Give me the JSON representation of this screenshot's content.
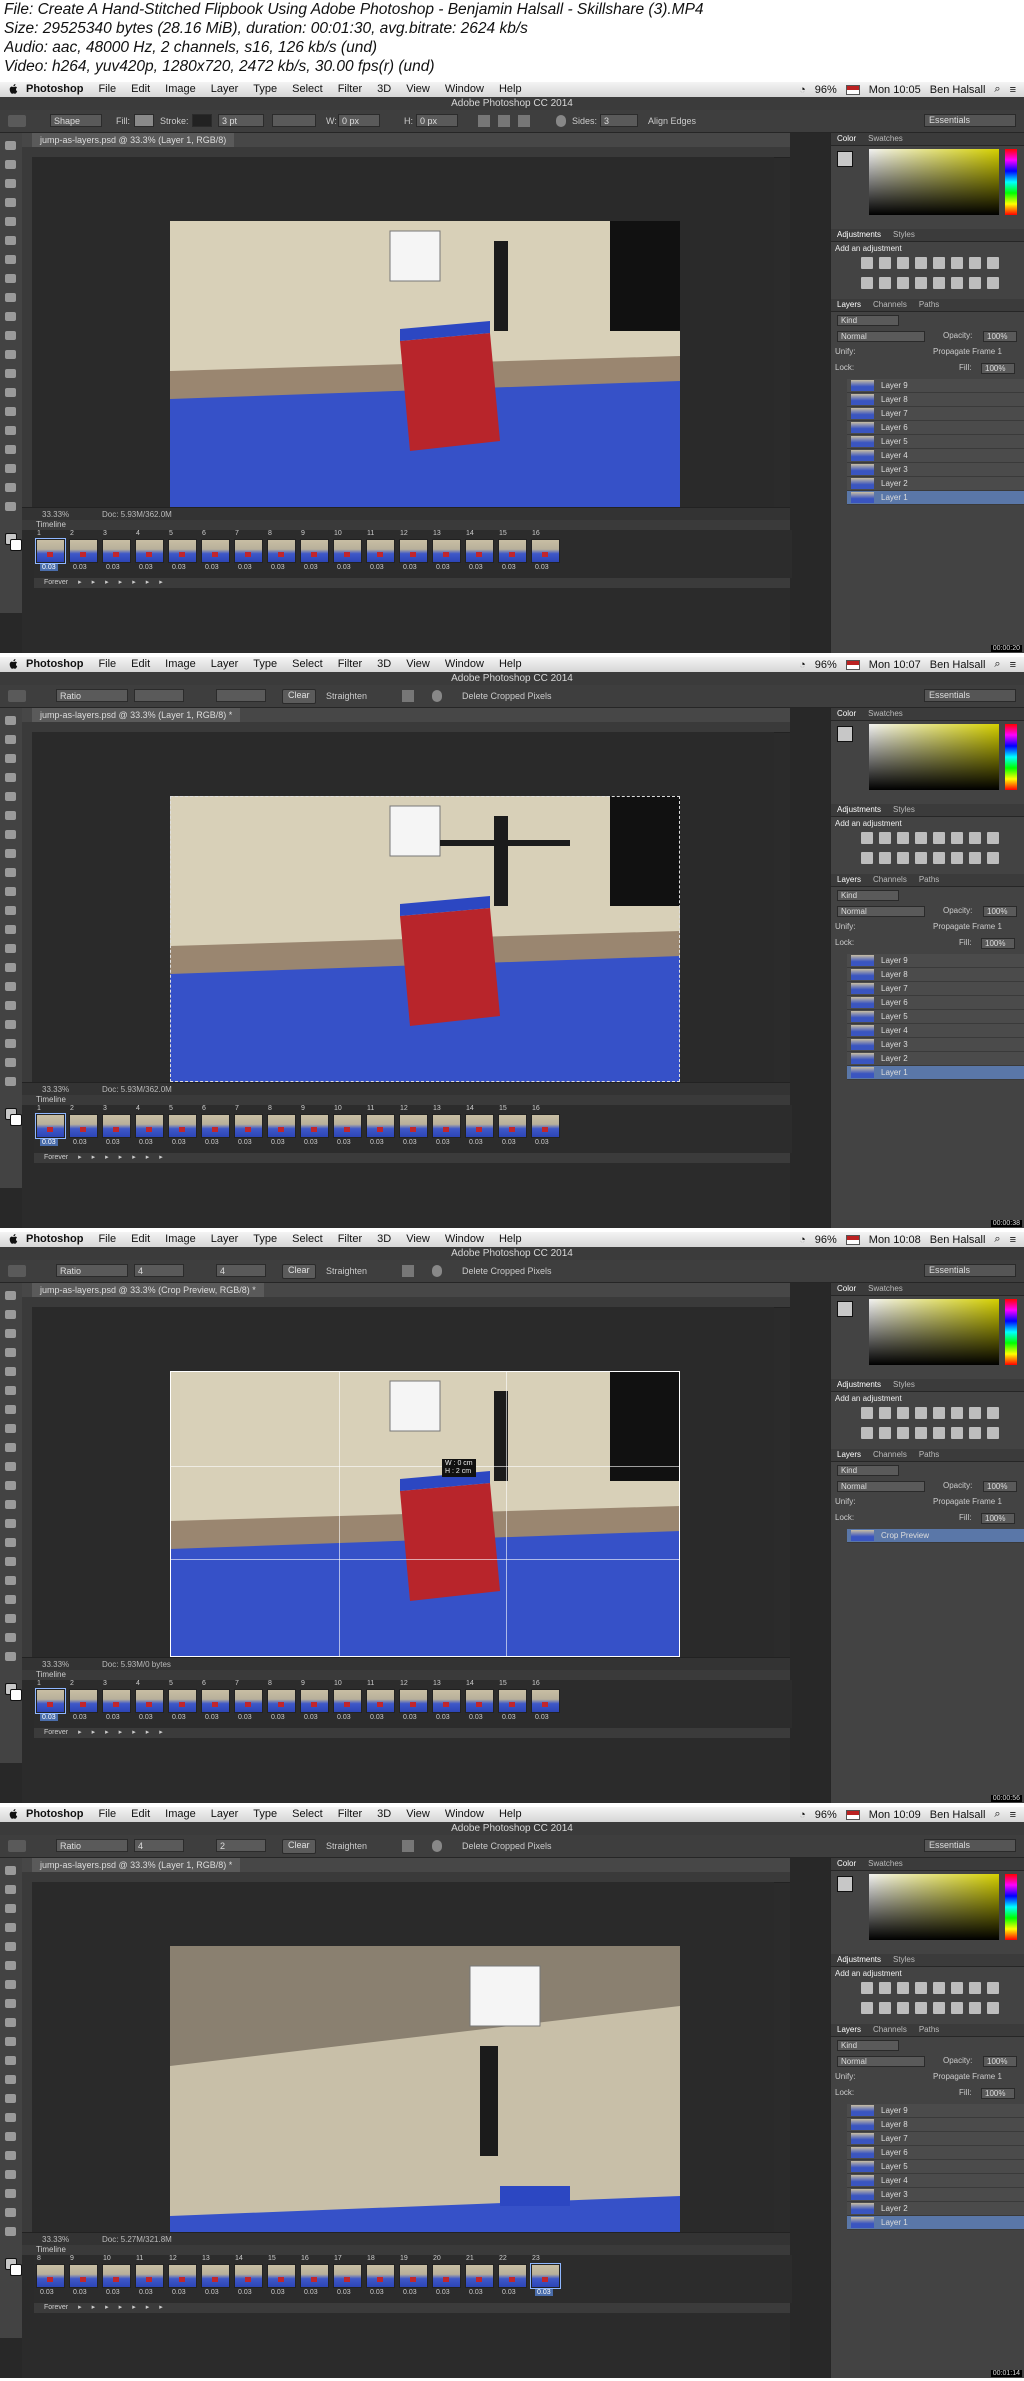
{
  "info": {
    "line1": "File: Create A Hand-Stitched Flipbook Using Adobe Photoshop - Benjamin Halsall - Skillshare (3).MP4",
    "line2": "Size: 29525340 bytes (28.16 MiB), duration: 00:01:30, avg.bitrate: 2624 kb/s",
    "line3": "Audio: aac, 48000 Hz, 2 channels, s16, 126 kb/s (und)",
    "line4": "Video: h264, yuv420p, 1280x720, 2472 kb/s, 30.00 fps(r) (und)"
  },
  "menus": [
    "Photoshop",
    "File",
    "Edit",
    "Image",
    "Layer",
    "Type",
    "Select",
    "Filter",
    "3D",
    "View",
    "Window",
    "Help"
  ],
  "status_user": "Ben Halsall",
  "status_battery": "96%",
  "app_title": "Adobe Photoshop CC 2014",
  "workspace": "Essentials",
  "panels": {
    "color_tab": "Color",
    "swatches_tab": "Swatches",
    "adjustments_tab": "Adjustments",
    "styles_tab": "Styles",
    "add_adjustment": "Add an adjustment",
    "layers_tab": "Layers",
    "channels_tab": "Channels",
    "paths_tab": "Paths",
    "kind": "Kind",
    "normal": "Normal",
    "opacity_label": "Opacity:",
    "opacity": "100%",
    "unify": "Unify:",
    "propagate": "Propagate Frame 1",
    "lock": "Lock:",
    "fill_label": "Fill:",
    "fill": "100%"
  },
  "timeline_label": "Timeline",
  "forever": "Forever",
  "frames_data": [
    {
      "clock": "Mon 10:05",
      "tool_options": {
        "shape": "Shape",
        "fill": "Fill:",
        "stroke": "Stroke:",
        "stroke_size": "3 pt",
        "w_label": "W:",
        "w": "0 px",
        "h_label": "H:",
        "h": "0 px",
        "sides_label": "Sides:",
        "sides": "3",
        "align": "Align Edges"
      },
      "doc_tab": "jump-as-layers.psd @ 33.3% (Layer 1, RGB/8)",
      "zoom": "33.33%",
      "doc_size": "Doc: 5.93M/362.0M",
      "frame_numbers": [
        "1",
        "2",
        "3",
        "4",
        "5",
        "6",
        "7",
        "8",
        "9",
        "10",
        "11",
        "12",
        "13",
        "14",
        "15",
        "16"
      ],
      "frame_delay": "0.03",
      "layers": [
        "Layer 9",
        "Layer 8",
        "Layer 7",
        "Layer 6",
        "Layer 5",
        "Layer 4",
        "Layer 3",
        "Layer 2",
        "Layer 1"
      ],
      "timecode": "00:00:20"
    },
    {
      "clock": "Mon 10:07",
      "tool_options": {
        "ratio": "Ratio",
        "clear": "Clear",
        "straighten": "Straighten",
        "delete_cropped": "Delete Cropped Pixels"
      },
      "doc_tab": "jump-as-layers.psd @ 33.3% (Layer 1, RGB/8) *",
      "zoom": "33.33%",
      "doc_size": "Doc: 5.93M/362.0M",
      "frame_numbers": [
        "1",
        "2",
        "3",
        "4",
        "5",
        "6",
        "7",
        "8",
        "9",
        "10",
        "11",
        "12",
        "13",
        "14",
        "15",
        "16"
      ],
      "frame_delay": "0.03",
      "layers": [
        "Layer 9",
        "Layer 8",
        "Layer 7",
        "Layer 6",
        "Layer 5",
        "Layer 4",
        "Layer 3",
        "Layer 2",
        "Layer 1"
      ],
      "timecode": "00:00:38"
    },
    {
      "clock": "Mon 10:08",
      "tool_options": {
        "ratio": "Ratio",
        "ratio_w": "4",
        "ratio_h": "4",
        "clear": "Clear",
        "straighten": "Straighten",
        "delete_cropped": "Delete Cropped Pixels"
      },
      "doc_tab": "jump-as-layers.psd @ 33.3% (Crop Preview, RGB/8) *",
      "zoom": "33.33%",
      "doc_size": "Doc: 5.93M/0 bytes",
      "crop_readout_w": "W : 0 cm",
      "crop_readout_h": "H : 2 cm",
      "frame_numbers": [
        "1",
        "2",
        "3",
        "4",
        "5",
        "6",
        "7",
        "8",
        "9",
        "10",
        "11",
        "12",
        "13",
        "14",
        "15",
        "16"
      ],
      "frame_delay": "0.03",
      "layers": [
        "Crop Preview"
      ],
      "timecode": "00:00:56"
    },
    {
      "clock": "Mon 10:09",
      "tool_options": {
        "ratio": "Ratio",
        "ratio_w": "4",
        "ratio_h": "2",
        "clear": "Clear",
        "straighten": "Straighten",
        "delete_cropped": "Delete Cropped Pixels"
      },
      "doc_tab": "jump-as-layers.psd @ 33.3% (Layer 1, RGB/8) *",
      "zoom": "33.33%",
      "doc_size": "Doc: 5.27M/321.8M",
      "frame_numbers": [
        "8",
        "9",
        "10",
        "11",
        "12",
        "13",
        "14",
        "15",
        "16",
        "17",
        "18",
        "19",
        "20",
        "21",
        "22",
        "23"
      ],
      "frame_delay": "0.03",
      "layers": [
        "Layer 9",
        "Layer 8",
        "Layer 7",
        "Layer 6",
        "Layer 5",
        "Layer 4",
        "Layer 3",
        "Layer 2",
        "Layer 1"
      ],
      "timecode": "00:01:14"
    }
  ]
}
